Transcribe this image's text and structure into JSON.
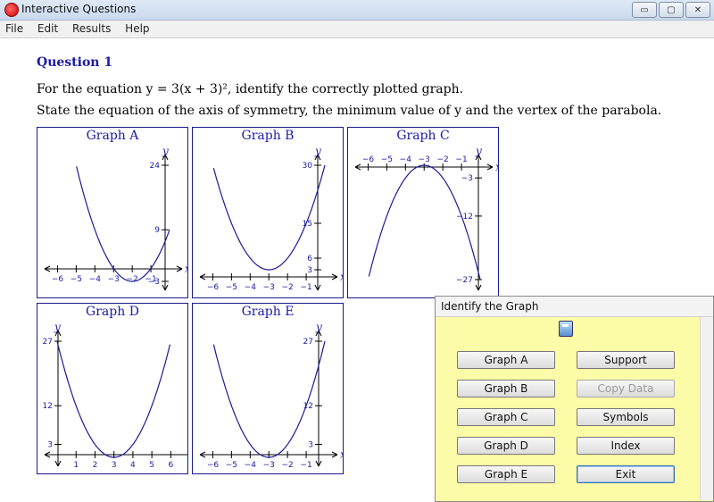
{
  "window": {
    "title": "Interactive Questions",
    "min": "▭",
    "max": "▢",
    "close": "✕"
  },
  "menu": [
    "File",
    "Edit",
    "Results",
    "Help"
  ],
  "question": {
    "title": "Question 1",
    "line1": "For the equation y = 3(x + 3)², identify the correctly plotted graph.",
    "line2": "State the equation of the axis of symmetry, the minimum value of y and the vertex of the parabola."
  },
  "graphs": [
    {
      "id": "a",
      "title": "Graph A",
      "xlabel": "x",
      "ylabel": "y",
      "ytick_labels": [
        "24",
        "9",
        "−3"
      ],
      "xtick_labels": [
        "−6",
        "−5",
        "−4",
        "−3",
        "−2",
        "−1"
      ]
    },
    {
      "id": "b",
      "title": "Graph B",
      "xlabel": "x",
      "ylabel": "y",
      "ytick_labels": [
        "30",
        "15",
        "6",
        "3"
      ],
      "xtick_labels": [
        "−6",
        "−5",
        "−4",
        "−3",
        "−2",
        "−1"
      ]
    },
    {
      "id": "c",
      "title": "Graph C",
      "xlabel": "x",
      "ylabel": "y",
      "ytick_labels": [
        "−3",
        "−12",
        "−27"
      ],
      "xtick_labels": [
        "−6",
        "−5",
        "−4",
        "−3",
        "−2",
        "−1"
      ]
    },
    {
      "id": "d",
      "title": "Graph D",
      "xlabel": "x",
      "ylabel": "y",
      "ytick_labels": [
        "27",
        "12",
        "3"
      ],
      "xtick_labels": [
        "1",
        "2",
        "3",
        "4",
        "5",
        "6"
      ]
    },
    {
      "id": "e",
      "title": "Graph E",
      "xlabel": "x",
      "ylabel": "y",
      "ytick_labels": [
        "27",
        "12",
        "3"
      ],
      "xtick_labels": [
        "−6",
        "−5",
        "−4",
        "−3",
        "−2",
        "−1"
      ]
    }
  ],
  "dialog": {
    "title": "Identify the Graph",
    "buttons_left": [
      "Graph A",
      "Graph B",
      "Graph C",
      "Graph D",
      "Graph E"
    ],
    "buttons_right": [
      "Support",
      "Copy Data",
      "Symbols",
      "Index",
      "Exit"
    ]
  },
  "chart_data": [
    {
      "type": "line",
      "title": "Graph A",
      "equation": "y = 3(x+2)^2 - 3",
      "x": [
        -6,
        -5,
        -4,
        -3,
        -2,
        -1,
        0
      ],
      "y": [
        45,
        24,
        9,
        0,
        -3,
        0,
        9
      ],
      "xlim": [
        -6.5,
        0
      ],
      "ylim": [
        -3,
        24
      ]
    },
    {
      "type": "line",
      "title": "Graph B",
      "equation": "y = 3(x+3)^2 + 3",
      "x": [
        -6,
        -5,
        -4,
        -3,
        -2,
        -1,
        0
      ],
      "y": [
        30,
        15,
        6,
        3,
        6,
        15,
        30
      ],
      "xlim": [
        -6.5,
        0
      ],
      "ylim": [
        0,
        30
      ]
    },
    {
      "type": "line",
      "title": "Graph C",
      "equation": "y = -3(x+3)^2",
      "x": [
        -6,
        -5,
        -4,
        -3,
        -2,
        -1,
        0
      ],
      "y": [
        -27,
        -12,
        -3,
        0,
        -3,
        -12,
        -27
      ],
      "xlim": [
        -6.5,
        0
      ],
      "ylim": [
        -27,
        0
      ]
    },
    {
      "type": "line",
      "title": "Graph D",
      "equation": "y = 3(x-3)^2",
      "x": [
        0,
        1,
        2,
        3,
        4,
        5,
        6
      ],
      "y": [
        27,
        12,
        3,
        0,
        3,
        12,
        27
      ],
      "xlim": [
        0,
        6.5
      ],
      "ylim": [
        0,
        27
      ]
    },
    {
      "type": "line",
      "title": "Graph E",
      "equation": "y = 3(x+3)^2",
      "x": [
        -6,
        -5,
        -4,
        -3,
        -2,
        -1,
        0
      ],
      "y": [
        27,
        12,
        3,
        0,
        3,
        12,
        27
      ],
      "xlim": [
        -6.5,
        0
      ],
      "ylim": [
        0,
        27
      ]
    }
  ]
}
